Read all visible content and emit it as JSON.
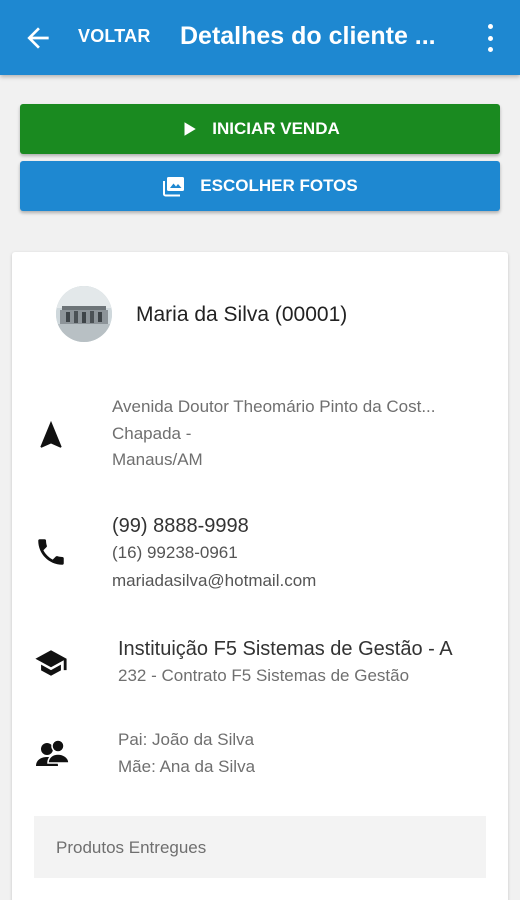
{
  "appbar": {
    "back_label": "VOLTAR",
    "title": "Detalhes do cliente ...",
    "back_icon": "arrow-left-icon",
    "menu_icon": "more-vert-icon",
    "color": "#1e88d1"
  },
  "actions": {
    "start_sale": {
      "label": "INICIAR VENDA",
      "icon": "play-icon",
      "color": "#1a8a20"
    },
    "choose_photos": {
      "label": "ESCOLHER FOTOS",
      "icon": "photo-library-icon",
      "color": "#1e88d1"
    }
  },
  "client": {
    "name": "Maria da Silva (00001)",
    "address": {
      "icon": "navigation-arrow-icon",
      "street": "Avenida Doutor Theomário Pinto da Cost...",
      "district": "Chapada -",
      "city": "Manaus/AM"
    },
    "contact": {
      "icon": "phone-icon",
      "phone_primary": "(99) 8888-9998",
      "phone_secondary": "(16) 99238-0961",
      "email": "mariadasilva@hotmail.com"
    },
    "institution": {
      "icon": "graduation-cap-icon",
      "name": "Instituição F5 Sistemas de Gestão - A",
      "contract": "232 - Contrato F5 Sistemas de Gestão"
    },
    "parents": {
      "icon": "people-icon",
      "father": "Pai: João da Silva",
      "mother": "Mãe: Ana da Silva"
    }
  },
  "delivered_products": {
    "label": "Produtos Entregues"
  }
}
